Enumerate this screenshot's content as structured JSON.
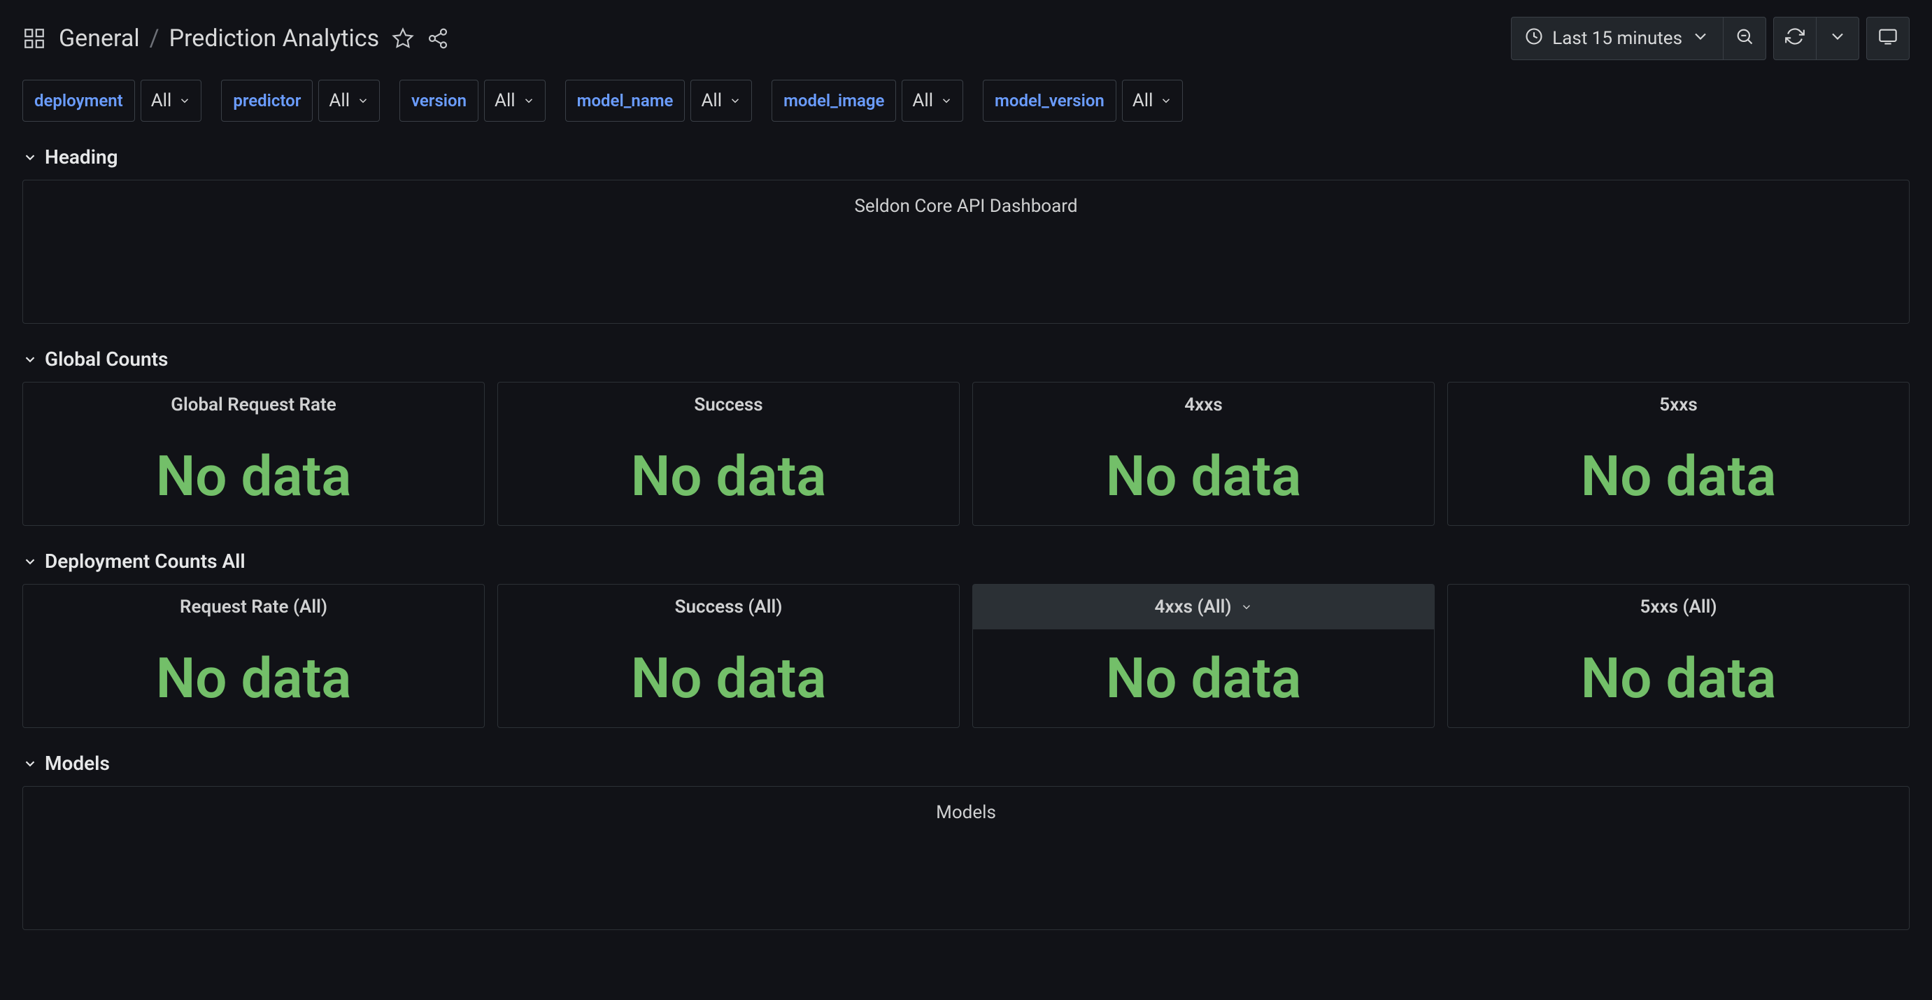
{
  "breadcrumbs": {
    "root": "General",
    "sep": "/",
    "current": "Prediction Analytics"
  },
  "time_picker": {
    "label": "Last 15 minutes"
  },
  "vars": [
    {
      "name": "deployment",
      "value": "All"
    },
    {
      "name": "predictor",
      "value": "All"
    },
    {
      "name": "version",
      "value": "All"
    },
    {
      "name": "model_name",
      "value": "All"
    },
    {
      "name": "model_image",
      "value": "All"
    },
    {
      "name": "model_version",
      "value": "All"
    }
  ],
  "rows": {
    "heading": {
      "title": "Heading",
      "text": "Seldon Core API Dashboard"
    },
    "global": {
      "title": "Global Counts",
      "panels": [
        {
          "title": "Global Request Rate",
          "value": "No data"
        },
        {
          "title": "Success",
          "value": "No data"
        },
        {
          "title": "4xxs",
          "value": "No data"
        },
        {
          "title": "5xxs",
          "value": "No data"
        }
      ]
    },
    "deploy": {
      "title": "Deployment Counts All",
      "panels": [
        {
          "title": "Request Rate (All)",
          "value": "No data"
        },
        {
          "title": "Success (All)",
          "value": "No data"
        },
        {
          "title": "4xxs (All)",
          "value": "No data"
        },
        {
          "title": "5xxs (All)",
          "value": "No data"
        }
      ]
    },
    "models": {
      "title": "Models",
      "text": "Models"
    }
  }
}
